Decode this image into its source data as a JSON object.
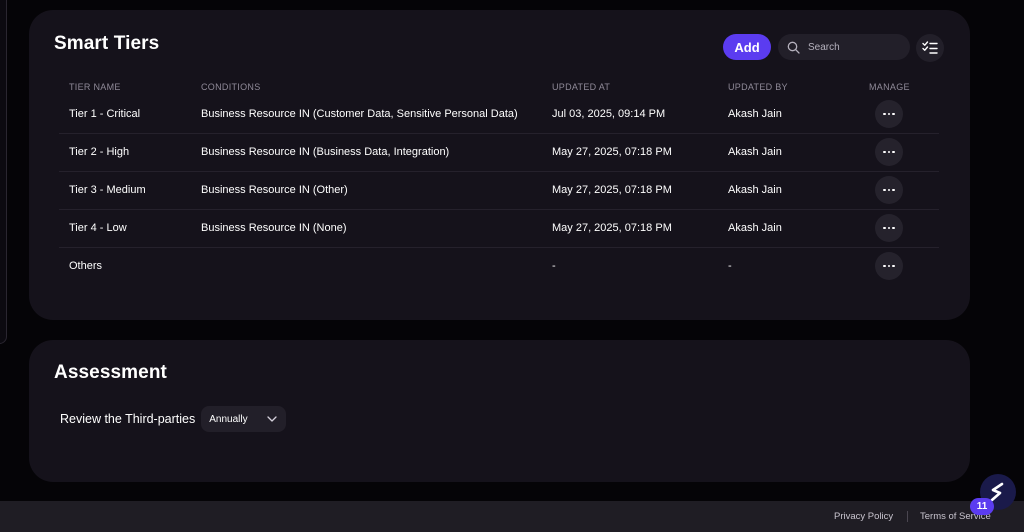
{
  "smart_tiers": {
    "title": "Smart Tiers",
    "add_label": "Add",
    "search_placeholder": "Search",
    "columns": [
      "TIER NAME",
      "CONDITIONS",
      "UPDATED AT",
      "UPDATED BY",
      "MANAGE"
    ],
    "rows": [
      {
        "name": "Tier 1 - Critical",
        "conditions": "Business Resource IN (Customer Data, Sensitive Personal Data)",
        "updated_at": "Jul 03, 2025, 09:14 PM",
        "updated_by": "Akash Jain"
      },
      {
        "name": "Tier 2 - High",
        "conditions": "Business Resource IN (Business Data, Integration)",
        "updated_at": "May 27, 2025, 07:18 PM",
        "updated_by": "Akash Jain"
      },
      {
        "name": "Tier 3 - Medium",
        "conditions": "Business Resource IN (Other)",
        "updated_at": "May 27, 2025, 07:18 PM",
        "updated_by": "Akash Jain"
      },
      {
        "name": "Tier 4 - Low",
        "conditions": "Business Resource IN (None)",
        "updated_at": "May 27, 2025, 07:18 PM",
        "updated_by": "Akash Jain"
      },
      {
        "name": "Others",
        "conditions": "",
        "updated_at": "-",
        "updated_by": "-"
      }
    ]
  },
  "assessment": {
    "title": "Assessment",
    "review_label": "Review the Third-parties",
    "frequency": "Annually"
  },
  "footer": {
    "privacy": "Privacy Policy",
    "terms": "Terms of Service"
  },
  "notification_count": "11",
  "colors": {
    "accent": "#5b3cf0",
    "card_bg": "#15121b",
    "page_bg": "#050407"
  },
  "icons": [
    "search-icon",
    "checklist-filter-icon",
    "more-horizontal-icon",
    "chevron-down-icon",
    "brand-logo-icon"
  ]
}
